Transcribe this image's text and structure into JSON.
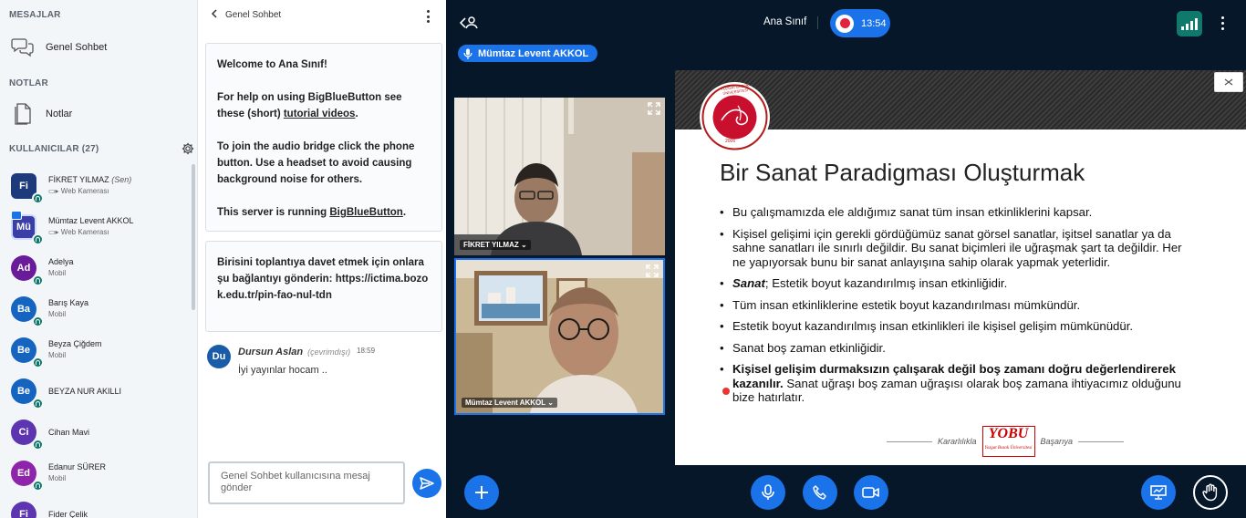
{
  "sidebar": {
    "messages_title": "MESAJLAR",
    "public_chat_label": "Genel Sohbet",
    "notes_title": "NOTLAR",
    "notes_label": "Notlar",
    "users_title": "KULLANICILAR (27)",
    "users": [
      {
        "initials": "Fi",
        "name": "FİKRET YILMAZ",
        "suffix": "(Sen)",
        "role": "Web Kamerası",
        "color": "#1d3a7a",
        "shape": "square"
      },
      {
        "initials": "Mü",
        "name": "Mümtaz Levent AKKOL",
        "suffix": "",
        "role": "Web Kamerası",
        "color": "#3a3fa8",
        "shape": "square"
      },
      {
        "initials": "Ad",
        "name": "Adelya",
        "suffix": "",
        "role": "Mobil",
        "color": "#6a1b9a",
        "shape": "round"
      },
      {
        "initials": "Ba",
        "name": "Barış Kaya",
        "suffix": "",
        "role": "Mobil",
        "color": "#1565c0",
        "shape": "round"
      },
      {
        "initials": "Be",
        "name": "Beyza Çiğdem",
        "suffix": "",
        "role": "Mobil",
        "color": "#1565c0",
        "shape": "round"
      },
      {
        "initials": "Be",
        "name": "BEYZA NUR AKILLI",
        "suffix": "",
        "role": "",
        "color": "#1565c0",
        "shape": "round"
      },
      {
        "initials": "Ci",
        "name": "Cihan Mavi",
        "suffix": "",
        "role": "",
        "color": "#5e35b1",
        "shape": "round"
      },
      {
        "initials": "Ed",
        "name": "Edanur SÜRER",
        "suffix": "",
        "role": "Mobil",
        "color": "#8e24aa",
        "shape": "round"
      },
      {
        "initials": "Fi",
        "name": "Fider Çelik",
        "suffix": "",
        "role": "",
        "color": "#5e35b1",
        "shape": "round"
      }
    ]
  },
  "chat": {
    "header": "Genel Sohbet",
    "welcome": {
      "line1_prefix": "Welcome to ",
      "line1_room": "Ana Sınıf",
      "line1_suffix": "!",
      "help_prefix": "For help on using BigBlueButton see these (short) ",
      "help_link": "tutorial videos",
      "help_suffix": ".",
      "audio": "To join the audio bridge click the phone button. Use a headset to avoid causing background noise for others.",
      "server_prefix": "This server is running ",
      "server_link": "BigBlueButton",
      "server_suffix": "."
    },
    "invite": "Birisini toplantıya davet etmek için onlara şu bağlantıyı gönderin: https://ictima.bozok.edu.tr/pin-fao-nul-tdn",
    "message": {
      "initials": "Du",
      "author": "Dursun Aslan",
      "status": "(çevrimdışı)",
      "time": "18:59",
      "text": "İyi yayınlar hocam .."
    },
    "input_placeholder": "Genel Sohbet kullanıcısına mesaj gönder"
  },
  "topbar": {
    "title": "Ana Sınıf",
    "recording_time": "13:54",
    "talker": "Mümtaz Levent AKKOL"
  },
  "videos": [
    {
      "name": "FİKRET YILMAZ"
    },
    {
      "name": "Mümtaz Levent AKKOL"
    }
  ],
  "slide": {
    "seal_top": "YOZGAT BOZOK ÜNİVERSİTESİ",
    "seal_year": "2006",
    "title": "Bir Sanat Paradigması Oluşturmak",
    "b1": "Bu çalışmamızda ele aldığımız sanat tüm insan etkinliklerini kapsar.",
    "b2": "Kişisel gelişimi için gerekli gördüğümüz sanat görsel sanatlar, işitsel sanatlar ya da sahne sanatları ile sınırlı değildir. Bu sanat biçimleri ile uğraşmak şart ta değildir. Her ne yapıyorsak bunu bir sanat anlayışına sahip olarak yapmak yeterlidir.",
    "b3_bold": "Sanat",
    "b3_rest": "; Estetik boyut kazandırılmış insan etkinliğidir.",
    "b4": "Tüm insan etkinliklerine estetik boyut kazandırılması mümkündür.",
    "b5": "Estetik boyut kazandırılmış insan etkinlikleri ile kişisel gelişim mümkünüdür.",
    "b6": "Sanat boş zaman etkinliğidir.",
    "b7_bold": "Kişisel gelişim durmaksızın çalışarak değil boş zamanı doğru değerlendirerek kazanılır.",
    "b7_rest": " Sanat uğraşı boş zaman uğraşısı olarak boş zamana ihtiyacımız olduğunu bize hatırlatır.",
    "footer_left": "Kararlılıkla",
    "footer_logo": "YOBU",
    "footer_logo_small": "Yozgat Bozok Üniversitesi",
    "footer_right": "Başarıya"
  },
  "colors": {
    "accent": "#1a73e8",
    "dark_bg": "#06172a",
    "record": "#e0243d",
    "voice": "#0f7a6c"
  }
}
